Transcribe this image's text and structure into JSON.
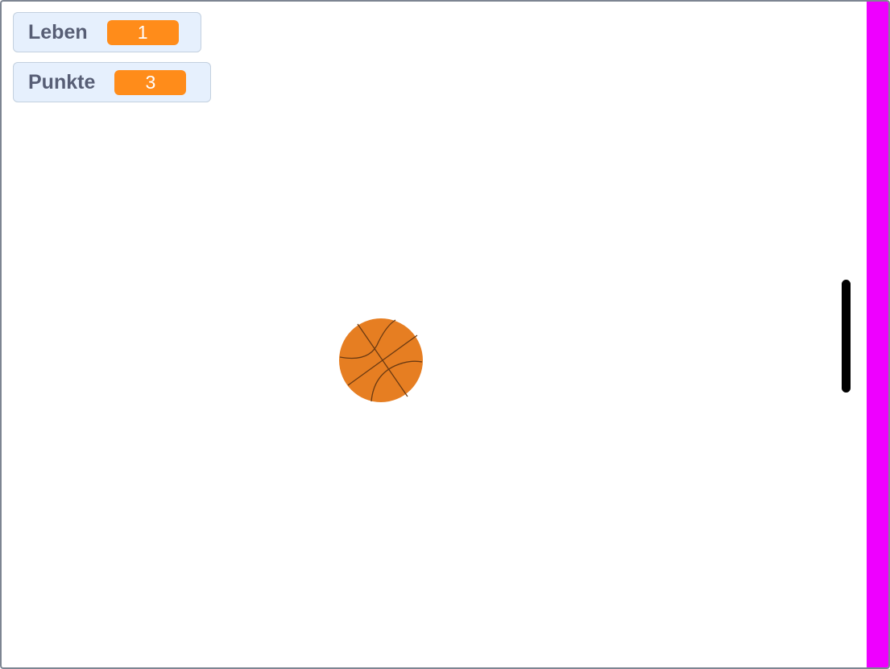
{
  "monitors": {
    "leben": {
      "label": "Leben",
      "value": "1"
    },
    "punkte": {
      "label": "Punkte",
      "value": "3"
    }
  },
  "sprites": {
    "ball": {
      "icon": "basketball-icon",
      "color": "#e67e22",
      "seam_color": "#6b3a12"
    },
    "paddle": {
      "color": "#000000"
    },
    "wall": {
      "color": "#ee00ff"
    }
  },
  "colors": {
    "monitor_value_bg": "#ff8c1a",
    "monitor_label": "#575e75",
    "monitor_bg": "#e6f0fd"
  }
}
